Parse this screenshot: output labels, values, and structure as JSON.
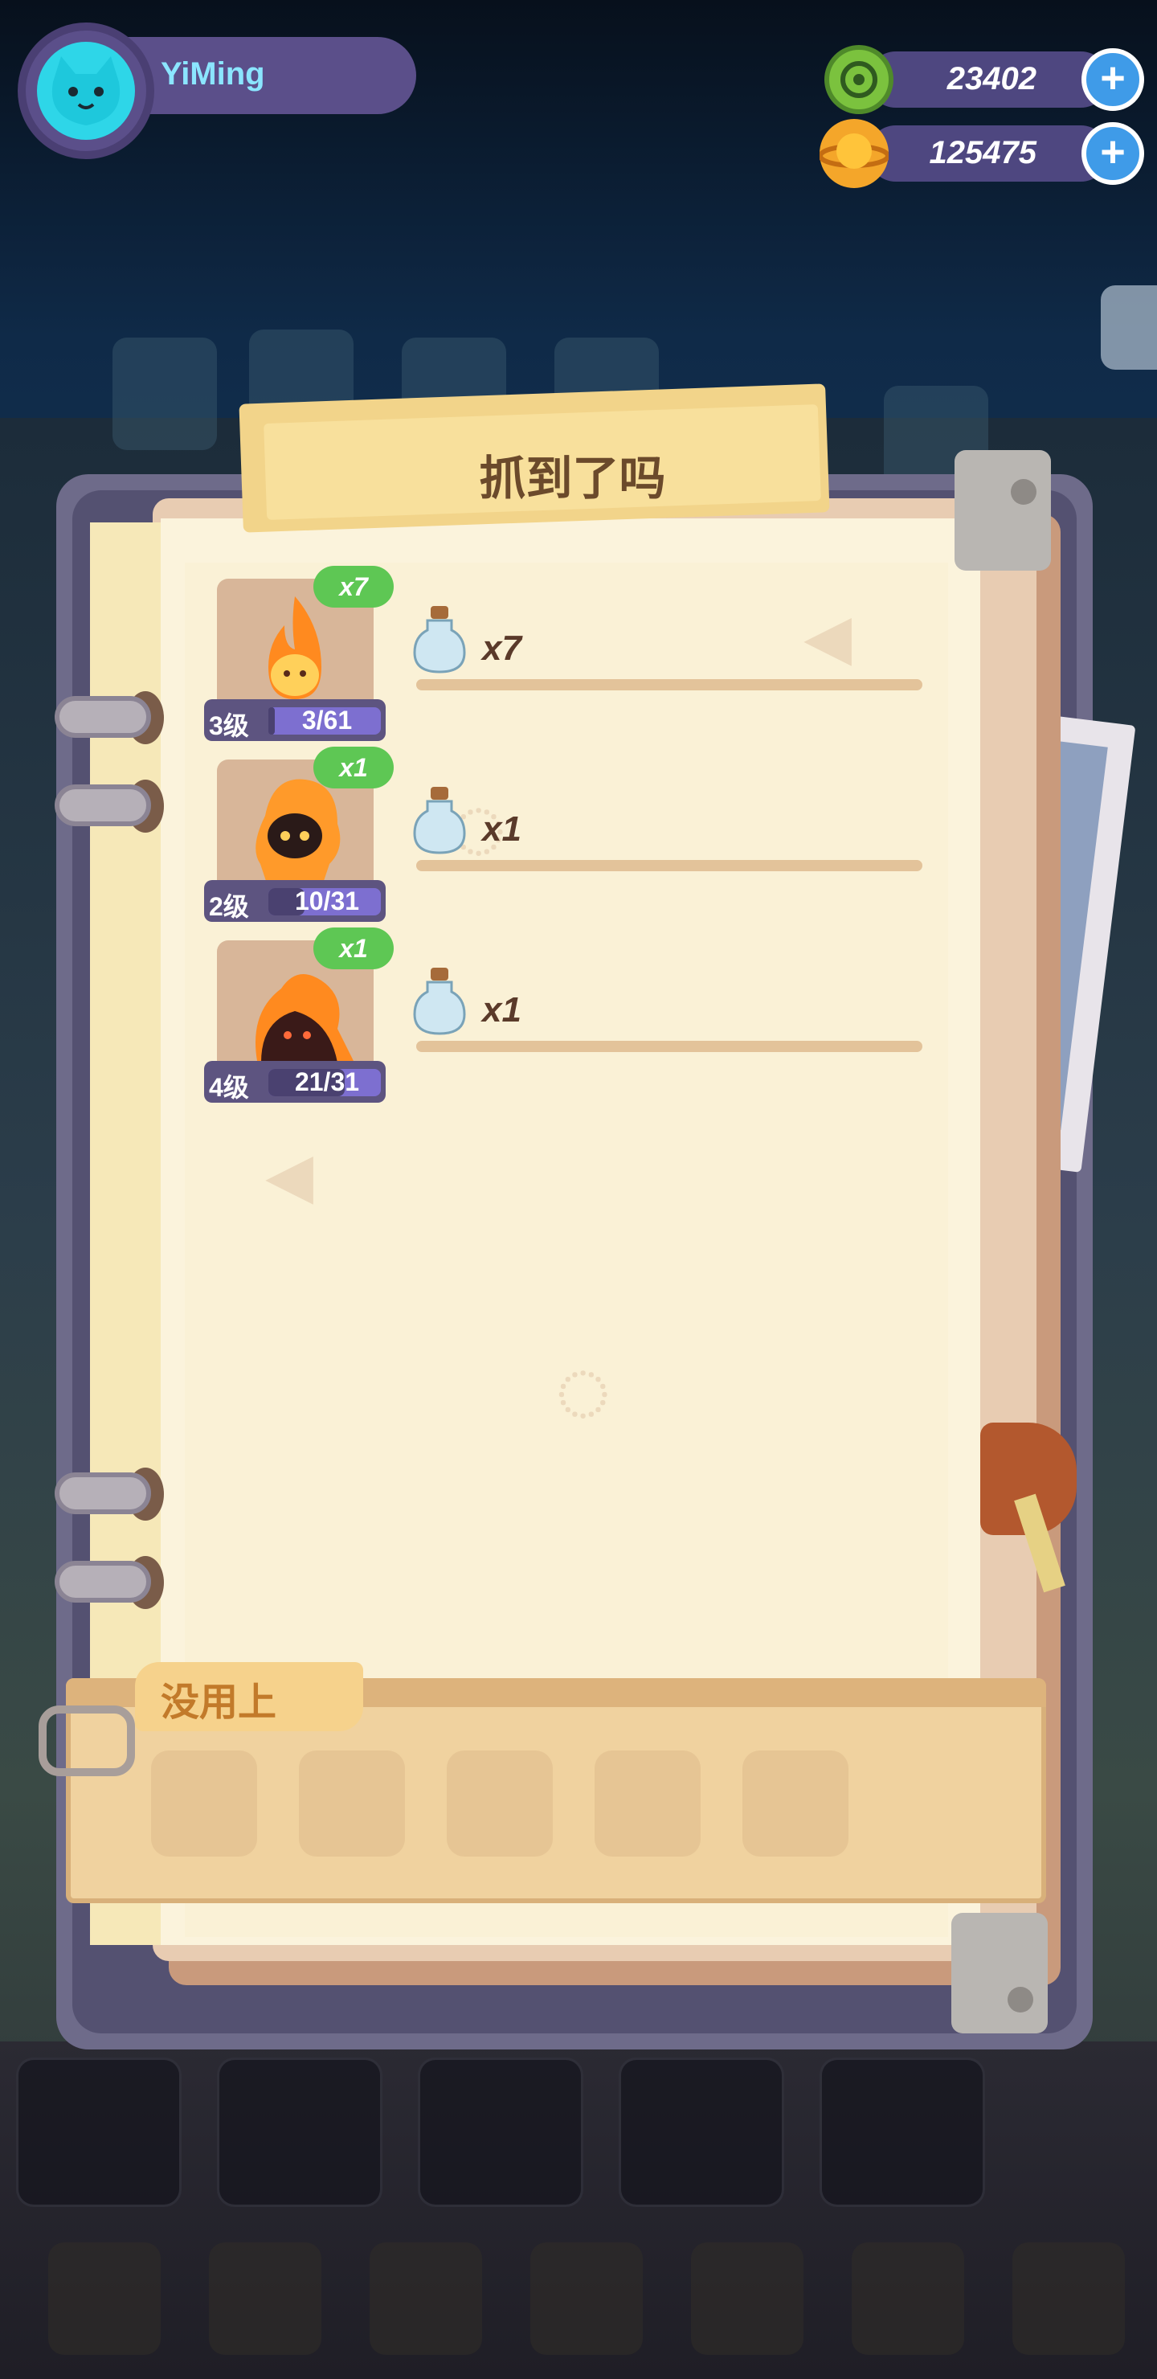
{
  "user": {
    "name": "YiMing"
  },
  "resources": {
    "gems": "23402",
    "coins": "125475"
  },
  "book": {
    "title": "抓到了吗",
    "entries": [
      {
        "count_badge": "x7",
        "level": "3级",
        "progress": "3/61",
        "bottle_count": "x7"
      },
      {
        "count_badge": "x1",
        "level": "2级",
        "progress": "10/31",
        "bottle_count": "x1"
      },
      {
        "count_badge": "x1",
        "level": "4级",
        "progress": "21/31",
        "bottle_count": "x1"
      }
    ],
    "unused_label": "没用上"
  },
  "icons": {
    "gem": "green-gem-icon",
    "coin": "planet-coin-icon",
    "plus": "plus-icon",
    "bottle": "bottle-icon"
  },
  "colors": {
    "accent_green": "#5ec754",
    "plus_blue": "#3f9be8",
    "hud_purple": "#5b4f8a"
  }
}
